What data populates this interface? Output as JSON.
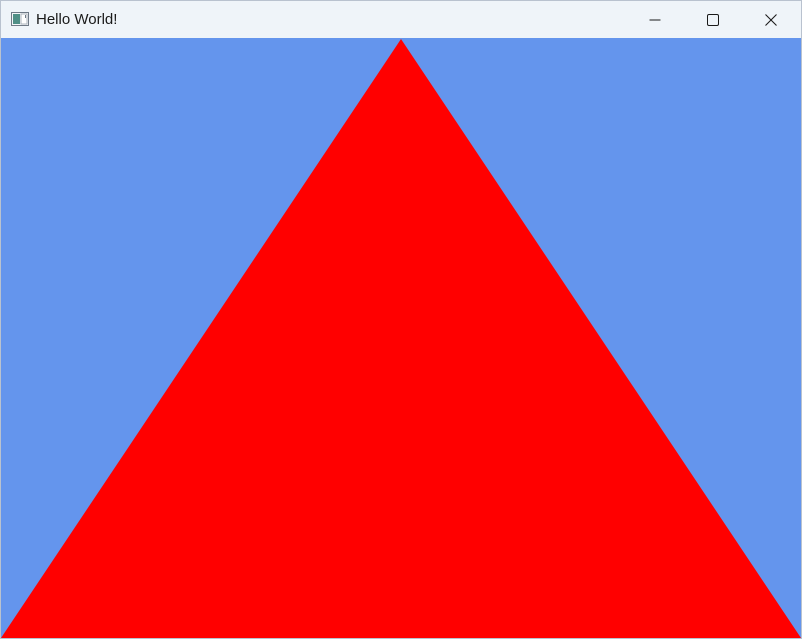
{
  "window": {
    "title": "Hello World!",
    "controls": {
      "minimize_icon": "minimize-icon",
      "maximize_icon": "maximize-icon",
      "close_icon": "close-icon"
    }
  },
  "scene": {
    "clear_color": "#6495ed",
    "shape": "triangle",
    "shape_color": "#ff0000"
  }
}
